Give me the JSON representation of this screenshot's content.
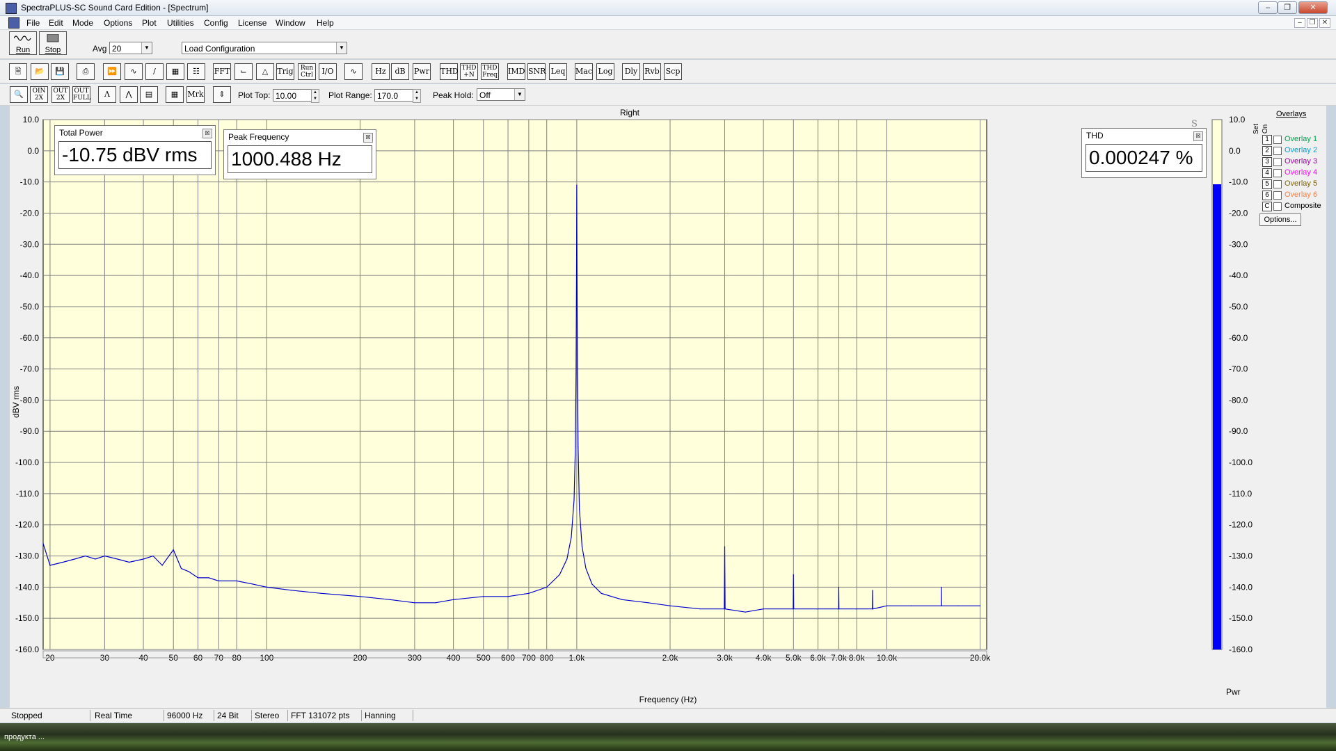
{
  "window": {
    "title": "SpectraPLUS-SC Sound Card Edition - [Spectrum]"
  },
  "menu": [
    "File",
    "Edit",
    "Mode",
    "Options",
    "Plot",
    "Utilities",
    "Config",
    "License",
    "Window",
    "Help"
  ],
  "toolbar": {
    "run_label": "Run",
    "stop_label": "Stop",
    "avg_label": "Avg",
    "avg_value": "20",
    "config_value": "Load Configuration",
    "buttons_row2": [
      "FFT",
      "Trig",
      "I/O",
      "Hz",
      "dB",
      "Pwr",
      "THD",
      "IMD",
      "SNR",
      "Leq",
      "Mac",
      "Log",
      "Dly",
      "Rvb",
      "Scp"
    ],
    "run_ctrl": [
      "Run",
      "Ctrl"
    ],
    "thd_n": [
      "THD",
      "+N"
    ],
    "thd_freq": [
      "THD",
      "Freq"
    ],
    "mrk_label": "Mrk",
    "zoom_in": [
      "OIN",
      "2X"
    ],
    "zoom_out": [
      "OUT",
      "2X"
    ],
    "zoom_full": [
      "OUT",
      "FULL"
    ],
    "plot_top_label": "Plot Top:",
    "plot_top_value": "10.00",
    "plot_range_label": "Plot Range:",
    "plot_range_value": "170.0",
    "peak_hold_label": "Peak Hold:",
    "peak_hold_value": "Off"
  },
  "plot": {
    "channel_title": "Right",
    "ylabel": "dBV rms",
    "xlabel": "Frequency (Hz)",
    "y_ticks": [
      "10.0",
      "0.0",
      "-10.0",
      "-20.0",
      "-30.0",
      "-40.0",
      "-50.0",
      "-60.0",
      "-70.0",
      "-80.0",
      "-90.0",
      "-100.0",
      "-110.0",
      "-120.0",
      "-130.0",
      "-140.0",
      "-150.0",
      "-160.0"
    ],
    "x_ticks": [
      "20",
      "30",
      "40",
      "50",
      "60",
      "70",
      "80",
      "100",
      "200",
      "300",
      "400",
      "500",
      "600",
      "700",
      "800",
      "1.0k",
      "2.0k",
      "3.0k",
      "4.0k",
      "5.0k",
      "6.0k",
      "7.0k",
      "8.0k",
      "10.0k",
      "20.0k"
    ],
    "pwr_label": "Pwr",
    "corner_glyph": "S"
  },
  "meters": {
    "total_power": {
      "title": "Total Power",
      "value": "-10.75 dBV rms"
    },
    "peak_frequency": {
      "title": "Peak Frequency",
      "value": "1000.488 Hz"
    },
    "thd": {
      "title": "THD",
      "value": "0.000247 %"
    }
  },
  "overlays": {
    "title": "Overlays",
    "set_label": "Set",
    "on_label": "On",
    "items": [
      {
        "num": "1",
        "label": "Overlay 1",
        "color": "#00a050"
      },
      {
        "num": "2",
        "label": "Overlay 2",
        "color": "#00a0c8"
      },
      {
        "num": "3",
        "label": "Overlay 3",
        "color": "#a000a0"
      },
      {
        "num": "4",
        "label": "Overlay 4",
        "color": "#ff00ff"
      },
      {
        "num": "5",
        "label": "Overlay 5",
        "color": "#806000"
      },
      {
        "num": "6",
        "label": "Overlay 6",
        "color": "#ff8040"
      },
      {
        "num": "C",
        "label": "Composite",
        "color": "#000000"
      }
    ],
    "options_label": "Options..."
  },
  "status": [
    "Stopped",
    "Real Time",
    "96000 Hz",
    "24 Bit",
    "Stereo",
    "FFT 131072 pts",
    "Hanning"
  ],
  "taskbar": {
    "label": "продукта ..."
  },
  "chart_data": {
    "type": "line",
    "title": "Right",
    "xlabel": "Frequency (Hz)",
    "ylabel": "dBV rms",
    "xscale": "log",
    "xlim": [
      19,
      21000
    ],
    "ylim": [
      -160,
      10
    ],
    "grid": true,
    "series": [
      {
        "color": "#0000cc",
        "points": [
          [
            19,
            -126
          ],
          [
            20,
            -133
          ],
          [
            22,
            -132
          ],
          [
            24,
            -131
          ],
          [
            26,
            -130
          ],
          [
            28,
            -131
          ],
          [
            30,
            -130
          ],
          [
            33,
            -131
          ],
          [
            36,
            -132
          ],
          [
            40,
            -131
          ],
          [
            43,
            -130
          ],
          [
            46,
            -133
          ],
          [
            50,
            -128
          ],
          [
            53,
            -134
          ],
          [
            56,
            -135
          ],
          [
            60,
            -137
          ],
          [
            65,
            -137
          ],
          [
            70,
            -138
          ],
          [
            80,
            -138
          ],
          [
            90,
            -139
          ],
          [
            100,
            -140
          ],
          [
            120,
            -141
          ],
          [
            150,
            -142
          ],
          [
            200,
            -143
          ],
          [
            250,
            -144
          ],
          [
            300,
            -145
          ],
          [
            350,
            -145
          ],
          [
            400,
            -144
          ],
          [
            500,
            -143
          ],
          [
            600,
            -143
          ],
          [
            700,
            -142
          ],
          [
            800,
            -140
          ],
          [
            880,
            -136
          ],
          [
            930,
            -131
          ],
          [
            960,
            -124
          ],
          [
            980,
            -112
          ],
          [
            990,
            -95
          ],
          [
            995,
            -70
          ],
          [
            998,
            -40
          ],
          [
            1000,
            -11
          ],
          [
            1002,
            -40
          ],
          [
            1005,
            -70
          ],
          [
            1010,
            -95
          ],
          [
            1020,
            -115
          ],
          [
            1040,
            -127
          ],
          [
            1070,
            -134
          ],
          [
            1120,
            -139
          ],
          [
            1200,
            -142
          ],
          [
            1400,
            -144
          ],
          [
            1700,
            -145
          ],
          [
            2000,
            -146
          ],
          [
            2500,
            -147
          ],
          [
            2990,
            -147
          ],
          [
            3000,
            -127
          ],
          [
            3010,
            -147
          ],
          [
            3500,
            -148
          ],
          [
            4000,
            -147
          ],
          [
            4990,
            -147
          ],
          [
            5000,
            -136
          ],
          [
            5010,
            -147
          ],
          [
            6000,
            -147
          ],
          [
            6990,
            -147
          ],
          [
            7000,
            -140
          ],
          [
            7010,
            -147
          ],
          [
            8000,
            -147
          ],
          [
            8990,
            -147
          ],
          [
            9000,
            -141
          ],
          [
            9010,
            -147
          ],
          [
            10000,
            -146
          ],
          [
            12000,
            -146
          ],
          [
            14990,
            -146
          ],
          [
            15000,
            -140
          ],
          [
            15010,
            -146
          ],
          [
            17000,
            -146
          ],
          [
            20000,
            -146
          ]
        ]
      }
    ],
    "pwr_bar": {
      "top": 10,
      "bottom": -160,
      "level": -10.75,
      "color": "#0000ff"
    }
  }
}
